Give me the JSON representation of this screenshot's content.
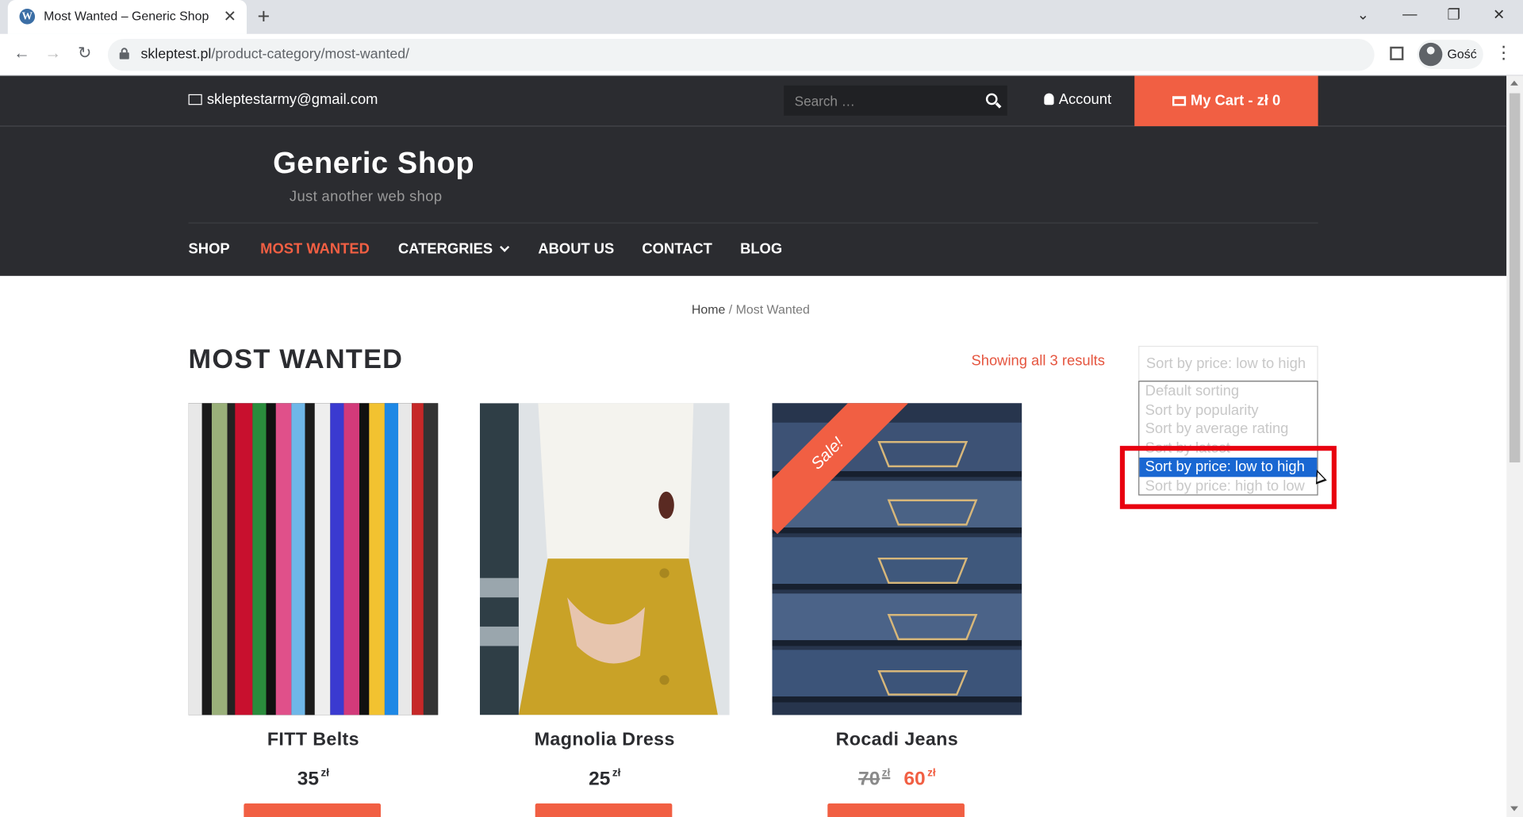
{
  "browser": {
    "tab_title": "Most Wanted – Generic Shop",
    "favicon": "wordpress-icon",
    "url_domain": "skleptest.pl",
    "url_path": "/product-category/most-wanted/",
    "profile_name": "Gość"
  },
  "topbar": {
    "email": "skleptestarmy@gmail.com",
    "search_placeholder": "Search …",
    "account_label": "Account",
    "cart_label": "My Cart - zł 0"
  },
  "site": {
    "title": "Generic Shop",
    "tagline": "Just another web shop"
  },
  "nav": {
    "items": [
      {
        "label": "SHOP",
        "active": false
      },
      {
        "label": "MOST WANTED",
        "active": true
      },
      {
        "label": "CATERGRIES",
        "active": false,
        "has_dropdown": true
      },
      {
        "label": "ABOUT US",
        "active": false
      },
      {
        "label": "CONTACT",
        "active": false
      },
      {
        "label": "BLOG",
        "active": false
      }
    ]
  },
  "breadcrumb": {
    "home": "Home",
    "separator": "/",
    "current": "Most Wanted"
  },
  "page": {
    "title": "MOST WANTED",
    "result_count": "Showing all 3 results"
  },
  "sorting": {
    "current": "Sort by price: low to high",
    "options": [
      "Default sorting",
      "Sort by popularity",
      "Sort by average rating",
      "Sort by latest",
      "Sort by price: low to high",
      "Sort by price: high to low"
    ],
    "selected_index": 4
  },
  "products": [
    {
      "name": "FITT Belts",
      "price": "35",
      "currency": "zł",
      "on_sale": false
    },
    {
      "name": "Magnolia Dress",
      "price": "25",
      "currency": "zł",
      "on_sale": false
    },
    {
      "name": "Rocadi Jeans",
      "old_price": "70",
      "price": "60",
      "currency": "zł",
      "on_sale": true,
      "badge": "Sale!"
    }
  ],
  "colors": {
    "accent": "#f15f43",
    "header_bg": "#2b2c30",
    "highlight": "#e8000f",
    "selected_option": "#1967d2"
  }
}
